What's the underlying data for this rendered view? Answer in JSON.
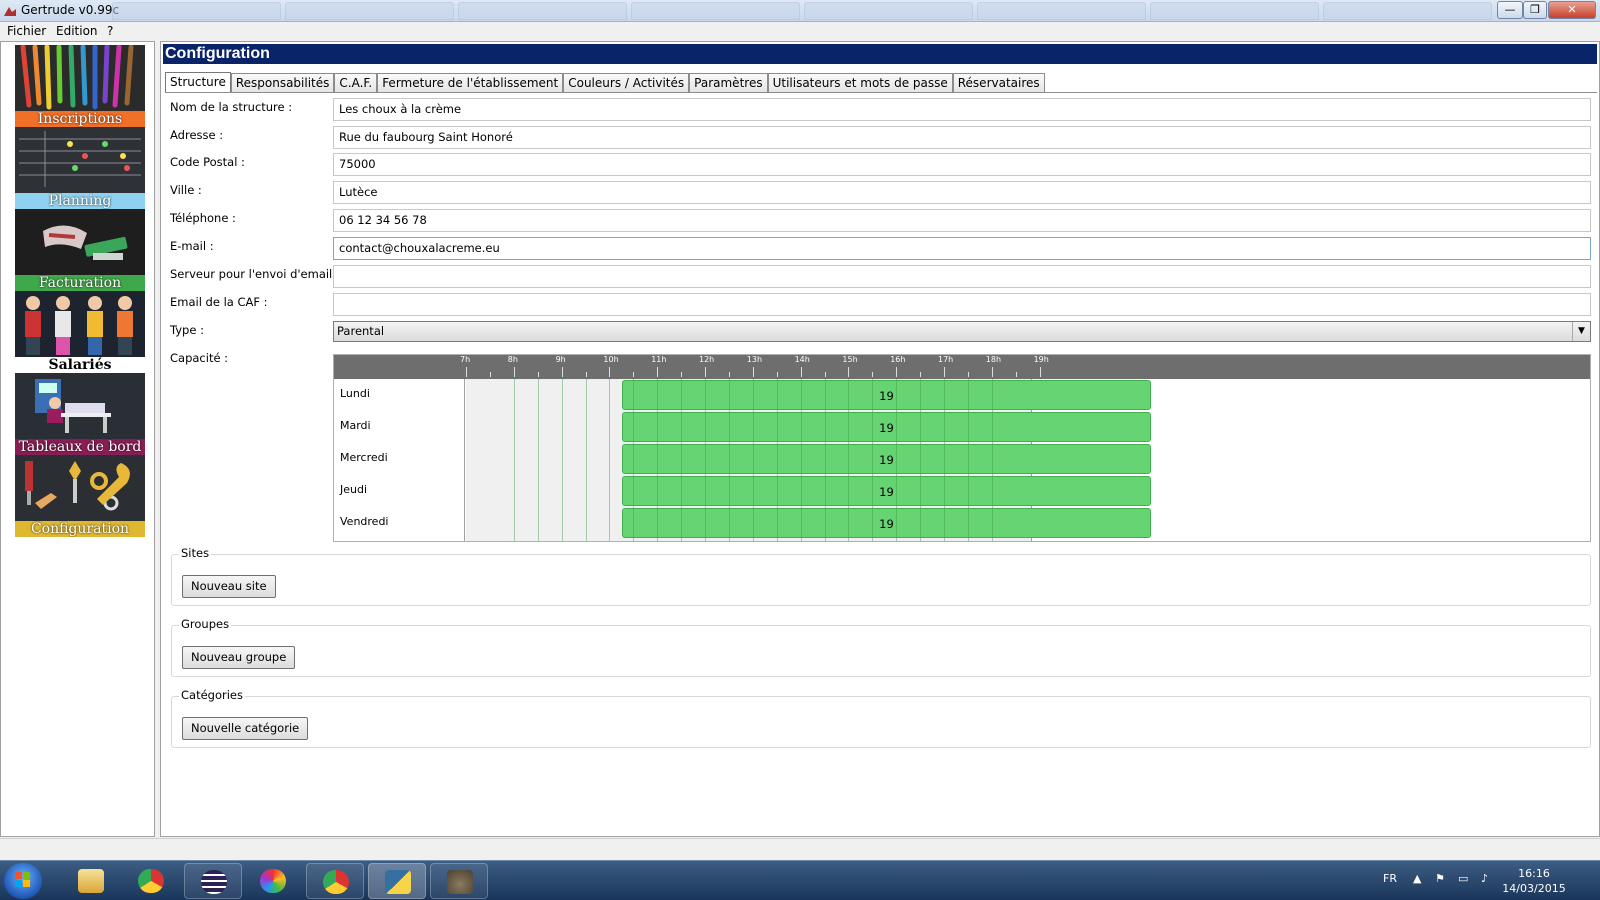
{
  "window": {
    "title": "Gertrude v0.99c",
    "minimize": "—",
    "maximize": "❐",
    "close": "✕"
  },
  "menu": [
    "Fichier",
    "Edition",
    "?"
  ],
  "sidebar": {
    "items": [
      {
        "label": "Inscriptions",
        "color": "#f07028"
      },
      {
        "label": "Planning",
        "color": "#8fd2f0"
      },
      {
        "label": "Facturation",
        "color": "#3fa84a"
      },
      {
        "label": "Salariés",
        "color": "#ffffff"
      },
      {
        "label": "Tableaux de bord",
        "color": "#8a1d55"
      },
      {
        "label": "Configuration",
        "color": "#e0b830"
      }
    ]
  },
  "panel": {
    "title": "Configuration"
  },
  "tabs": [
    "Structure",
    "Responsabilités",
    "C.A.F.",
    "Fermeture de l'établissement",
    "Couleurs / Activités",
    "Paramètres",
    "Utilisateurs et mots de passe",
    "Réservataires"
  ],
  "form": {
    "fields": [
      {
        "label": "Nom de la structure :",
        "value": "Les choux à la crème"
      },
      {
        "label": "Adresse :",
        "value": "Rue du faubourg Saint Honoré"
      },
      {
        "label": "Code Postal :",
        "value": "75000"
      },
      {
        "label": "Ville :",
        "value": "Lutèce"
      },
      {
        "label": "Téléphone :",
        "value": "06 12 34 56 78"
      },
      {
        "label": "E-mail :",
        "value": "contact@chouxalacreme.eu"
      },
      {
        "label": "Serveur pour l'envoi d'emails :",
        "value": ""
      },
      {
        "label": "Email de la CAF :",
        "value": ""
      }
    ],
    "type_label": "Type :",
    "type_value": "Parental",
    "capacity_label": "Capacité :"
  },
  "capacity": {
    "hours": [
      "7h",
      "8h",
      "9h",
      "10h",
      "11h",
      "12h",
      "13h",
      "14h",
      "15h",
      "16h",
      "17h",
      "18h",
      "19h"
    ],
    "days": [
      "Lundi",
      "Mardi",
      "Mercredi",
      "Jeudi",
      "Vendredi"
    ],
    "value": "19",
    "color": "#66d472"
  },
  "groups": [
    {
      "title": "Sites",
      "button": "Nouveau site"
    },
    {
      "title": "Groupes",
      "button": "Nouveau groupe"
    },
    {
      "title": "Catégories",
      "button": "Nouvelle catégorie"
    }
  ],
  "taskbar": {
    "language": "FR",
    "time": "16:16",
    "date": "14/03/2015"
  }
}
